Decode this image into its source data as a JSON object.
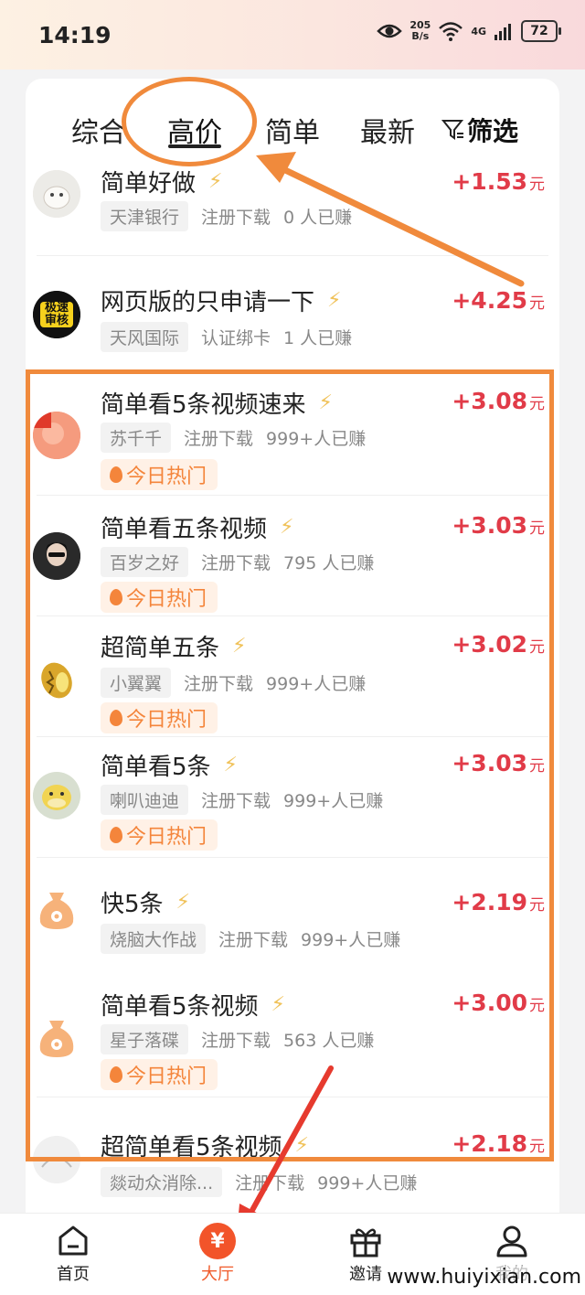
{
  "status_bar": {
    "time": "14:19",
    "net_speed_value": "205",
    "net_speed_unit": "B/s",
    "network_label": "4G",
    "battery": "72"
  },
  "tabs": {
    "items": [
      "综合",
      "高价",
      "简单",
      "最新"
    ],
    "active": "高价",
    "filter_label": "筛选"
  },
  "tasks": [
    {
      "title": "简单好做",
      "price": "+1.53",
      "unit": "元",
      "sponsor": "天津银行",
      "task_type": "注册下载",
      "earned": "0 人已赚",
      "hot": ""
    },
    {
      "title": "网页版的只申请一下",
      "price": "+4.25",
      "unit": "元",
      "sponsor": "天风国际",
      "task_type": "认证绑卡",
      "earned": "1 人已赚",
      "hot": "",
      "avatar_text": "极速审核"
    },
    {
      "title": "简单看5条视频速来",
      "price": "+3.08",
      "unit": "元",
      "sponsor": "苏千千",
      "task_type": "注册下载",
      "earned": "999+人已赚",
      "hot": "今日热门"
    },
    {
      "title": "简单看五条视频",
      "price": "+3.03",
      "unit": "元",
      "sponsor": "百岁之好",
      "task_type": "注册下载",
      "earned": "795 人已赚",
      "hot": "今日热门"
    },
    {
      "title": "超简单五条",
      "price": "+3.02",
      "unit": "元",
      "sponsor": "小翼翼",
      "task_type": "注册下载",
      "earned": "999+人已赚",
      "hot": "今日热门"
    },
    {
      "title": "简单看5条",
      "price": "+3.03",
      "unit": "元",
      "sponsor": "喇叭迪迪",
      "task_type": "注册下载",
      "earned": "999+人已赚",
      "hot": "今日热门"
    },
    {
      "title": "快5条",
      "price": "+2.19",
      "unit": "元",
      "sponsor": "烧脑大作战",
      "task_type": "注册下载",
      "earned": "999+人已赚",
      "hot": ""
    },
    {
      "title": "简单看5条视频",
      "price": "+3.00",
      "unit": "元",
      "sponsor": "星子落碟",
      "task_type": "注册下载",
      "earned": "563 人已赚",
      "hot": "今日热门"
    },
    {
      "title": "超简单看5条视频",
      "price": "+2.18",
      "unit": "元",
      "sponsor": "燚动众消除...",
      "task_type": "注册下载",
      "earned": "999+人已赚",
      "hot": ""
    }
  ],
  "bottom_nav": {
    "home": "首页",
    "hall": "大厅",
    "hall_icon": "¥",
    "invite": "邀请",
    "mine": "我的"
  },
  "watermark": "www.huiyixian.com",
  "colors": {
    "accent_orange": "#f08a3c",
    "price_red": "#e13b48",
    "nav_active": "#f05a2a"
  }
}
